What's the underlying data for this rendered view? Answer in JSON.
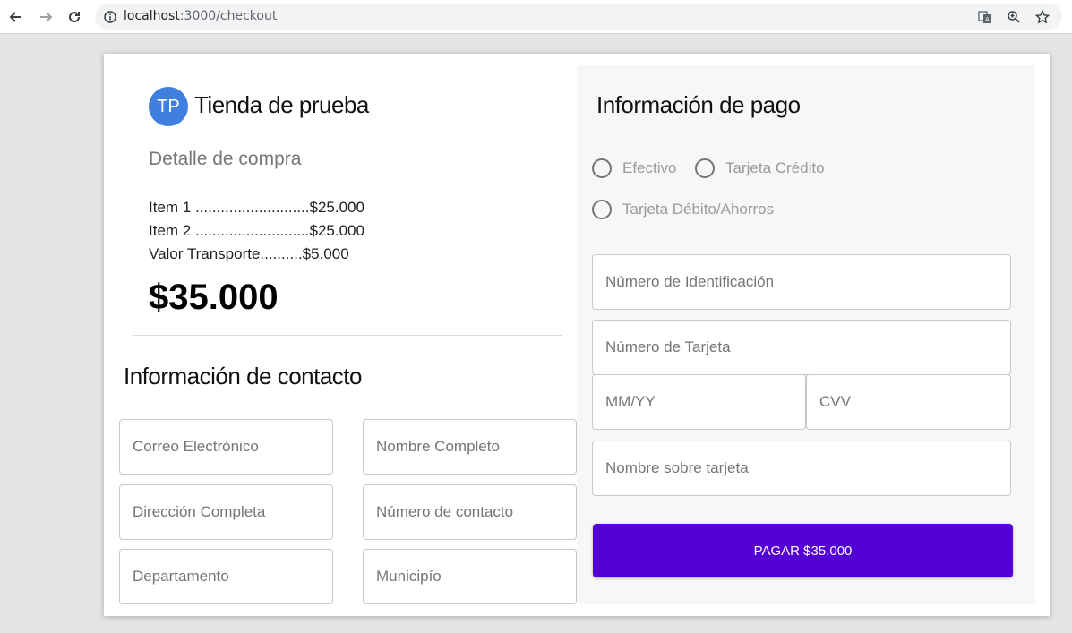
{
  "browser": {
    "url_host": "localhost",
    "url_path": ":3000/checkout"
  },
  "store": {
    "avatar_initials": "TP",
    "name": "Tienda de prueba"
  },
  "order": {
    "title": "Detalle de compra",
    "items": [
      {
        "label": "Item 1 ...........................",
        "price": "$25.000"
      },
      {
        "label": "Item 2 ...........................",
        "price": "$25.000"
      },
      {
        "label": "Valor Transporte..........",
        "price": "$5.000"
      }
    ],
    "total": "$35.000"
  },
  "contact": {
    "title": "Información de contacto",
    "fields": {
      "email": "Correo Electrónico",
      "full_name": "Nombre Completo",
      "address": "Dirección Completa",
      "phone": "Número de contacto",
      "department": "Departamento",
      "municipality": "Municipío"
    }
  },
  "payment": {
    "title": "Información de pago",
    "methods": [
      "Efectivo",
      "Tarjeta Crédito",
      "Tarjeta Débito/Ahorros"
    ],
    "fields": {
      "id_number": "Número de Identificación",
      "card_number": "Número de Tarjeta",
      "expiry": "MM/YY",
      "cvv": "CVV",
      "card_name": "Nombre sobre tarjeta"
    },
    "pay_button": "PAGAR $35.000",
    "accent_color": "#5300d4"
  }
}
